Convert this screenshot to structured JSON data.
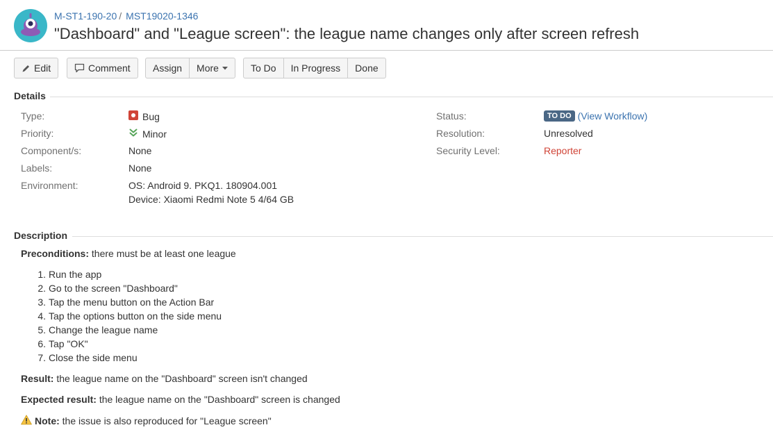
{
  "breadcrumbs": {
    "project": "M-ST1-190-20",
    "separator": "/",
    "issue_key": "MST19020-1346"
  },
  "issue": {
    "title": "\"Dashboard\" and \"League screen\": the league name changes only after screen refresh"
  },
  "toolbar": {
    "edit": "Edit",
    "comment": "Comment",
    "assign": "Assign",
    "more": "More",
    "todo": "To Do",
    "in_progress": "In Progress",
    "done": "Done"
  },
  "details": {
    "heading": "Details",
    "type_label": "Type:",
    "type_value": "Bug",
    "priority_label": "Priority:",
    "priority_value": "Minor",
    "components_label": "Component/s:",
    "components_value": "None",
    "labels_label": "Labels:",
    "labels_value": "None",
    "environment_label": "Environment:",
    "environment_line1": "OS: Android 9. PKQ1. 180904.001",
    "environment_line2": "Device: Xiaomi Redmi Note 5 4/64 GB",
    "status_label": "Status:",
    "status_value": "TO DO",
    "view_workflow_open": "(",
    "view_workflow": "View Workflow",
    "view_workflow_close": ")",
    "resolution_label": "Resolution:",
    "resolution_value": "Unresolved",
    "security_label": "Security Level:",
    "security_value": "Reporter"
  },
  "description": {
    "heading": "Description",
    "preconditions_label": "Preconditions:",
    "preconditions_text": " there must be at least one league",
    "steps": [
      {
        "num": "1.",
        "text": "Run the app"
      },
      {
        "num": "2.",
        "text": "Go to the screen \"Dashboard\""
      },
      {
        "num": "3.",
        "text": "Tap the menu button on the Action Bar"
      },
      {
        "num": "4.",
        "text": "Tap the options button on the side menu"
      },
      {
        "num": "5.",
        "text": "Change the league name"
      },
      {
        "num": "6.",
        "text": "Tap \"OK\""
      },
      {
        "num": "7.",
        "text": "Close the side menu"
      }
    ],
    "result_label": "Result:",
    "result_text": " the league name on the \"Dashboard\" screen isn't changed",
    "expected_label": "Expected result:",
    "expected_text": " the league name on the \"Dashboard\" screen is changed",
    "note_label": "Note:",
    "note_text": " the issue is also reproduced for \"League screen\""
  },
  "colors": {
    "link": "#3b73af",
    "bug": "#d04437",
    "priority": "#57a55a",
    "lozenge": "#4a6785",
    "avatar_bg": "#3ab7c8"
  },
  "icons": {
    "avatar": "project-avatar-icon",
    "edit": "pencil-icon",
    "comment": "speech-bubble-icon",
    "more": "caret-down-icon",
    "type": "bug-icon",
    "priority": "double-chevron-down-icon",
    "note": "warning-icon"
  }
}
